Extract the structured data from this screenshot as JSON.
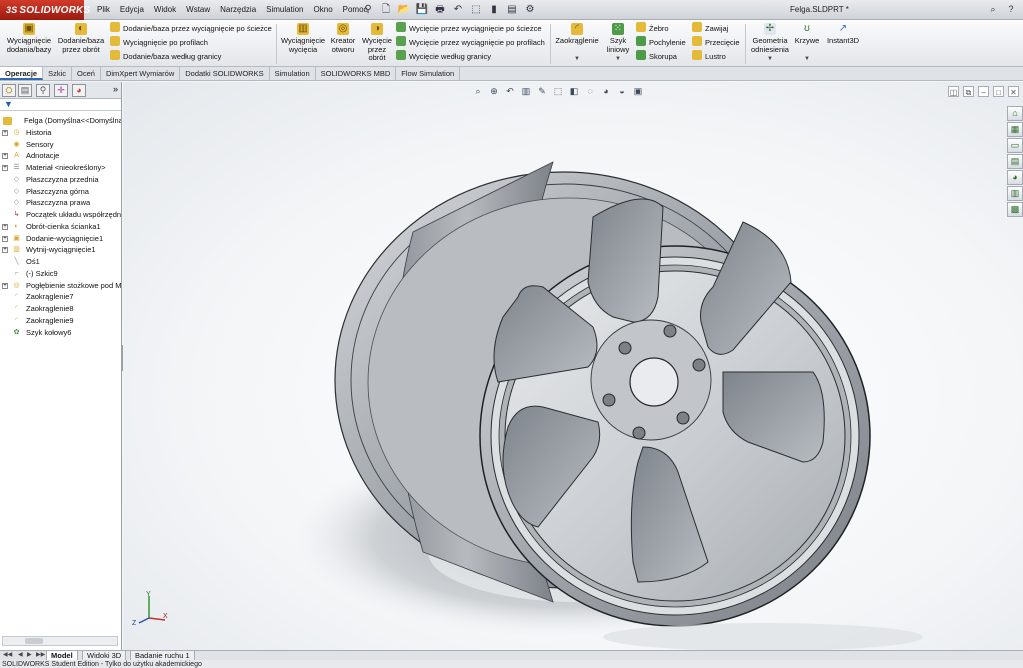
{
  "app": {
    "brand": "SOLIDWORKS",
    "brand_prefix": "3S",
    "document_title": "Felga.SLDPRT *"
  },
  "menu": [
    "Plik",
    "Edycja",
    "Widok",
    "Wstaw",
    "Narzędzia",
    "Simulation",
    "Okno",
    "Pomoc"
  ],
  "ribbon": {
    "extrude_boss": "Wyciągnięcie dodania/bazy",
    "revolve_boss": "Dodanie/baza przez obrót",
    "sweep_boss": "Dodanie/baza przez wyciągnięcie po ścieżce",
    "loft_boss": "Wyciągnięcie po profilach",
    "boundary_boss": "Dodanie/baza według granicy",
    "extrude_cut": "Wyciągnięcie wycięcia",
    "hole_wizard": "Kreator otworu",
    "revolve_cut": "Wycięcie przez obrót",
    "sweep_cut": "Wycięcie przez wyciągnięcie po ścieżce",
    "loft_cut": "Wycięcie przez wyciągnięcie po profilach",
    "boundary_cut": "Wycięcie według granicy",
    "fillet": "Zaokrąglenie",
    "linear_pattern": "Szyk liniowy",
    "rib": "Żebro",
    "draft": "Pochylenie",
    "shell": "Skorupa",
    "wrap": "Zawijaj",
    "intersect": "Przecięcie",
    "mirror": "Lustro",
    "ref_geometry": "Geometria odniesienia",
    "curves": "Krzywe",
    "instant3d": "Instant3D"
  },
  "tabs": [
    "Operacje",
    "Szkic",
    "Oceń",
    "DimXpert Wymiarów",
    "Dodatki SOLIDWORKS",
    "Simulation",
    "SOLIDWORKS MBD",
    "Flow Simulation"
  ],
  "active_tab": "Operacje",
  "feature_tree": {
    "root": "Felga  (Domyślna<<Domyślna>_Stan wyświetlania 1>)",
    "items": [
      {
        "label": "Historia",
        "expand": true,
        "icon": "history-icon",
        "color": "#d9a52b"
      },
      {
        "label": "Sensory",
        "expand": false,
        "icon": "sensor-icon",
        "color": "#d9a52b"
      },
      {
        "label": "Adnotacje",
        "expand": true,
        "icon": "annotation-icon",
        "color": "#d9a52b"
      },
      {
        "label": "Materiał <nieokreślony>",
        "expand": true,
        "icon": "material-icon",
        "color": "#6a7c8f"
      },
      {
        "label": "Płaszczyzna przednia",
        "expand": false,
        "icon": "plane-icon",
        "color": "#8a8f96"
      },
      {
        "label": "Płaszczyzna górna",
        "expand": false,
        "icon": "plane-icon",
        "color": "#8a8f96"
      },
      {
        "label": "Płaszczyzna prawa",
        "expand": false,
        "icon": "plane-icon",
        "color": "#8a8f96"
      },
      {
        "label": "Początek układu współrzędnych",
        "expand": false,
        "icon": "origin-icon",
        "color": "#b0332a"
      },
      {
        "label": "Obrót-cienka ścianka1",
        "expand": true,
        "icon": "revolve-icon",
        "color": "#d9a52b"
      },
      {
        "label": "Dodanie-wyciągnięcie1",
        "expand": true,
        "icon": "extrude-icon",
        "color": "#d9a52b"
      },
      {
        "label": "Wytnij-wyciągnięcie1",
        "expand": true,
        "icon": "cut-icon",
        "color": "#d9a52b"
      },
      {
        "label": "Oś1",
        "expand": false,
        "icon": "axis-icon",
        "color": "#8a8f96"
      },
      {
        "label": "(-) Szkic9",
        "expand": false,
        "icon": "sketch-icon",
        "color": "#8a8f96"
      },
      {
        "label": "Pogłębienie stożkowe pod M",
        "expand": true,
        "icon": "countersink-icon",
        "color": "#d9a52b"
      },
      {
        "label": "Zaokrąglenie7",
        "expand": false,
        "icon": "fillet-icon",
        "color": "#d9a52b"
      },
      {
        "label": "Zaokrąglenie8",
        "expand": false,
        "icon": "fillet-icon",
        "color": "#d9a52b"
      },
      {
        "label": "Zaokrąglenie9",
        "expand": false,
        "icon": "fillet-icon",
        "color": "#d9a52b"
      },
      {
        "label": "Szyk kołowy6",
        "expand": false,
        "icon": "circular-pattern-icon",
        "color": "#3f8f3f"
      }
    ]
  },
  "bottom_tabs": [
    "Model",
    "Widoki 3D",
    "Badanie ruchu 1"
  ],
  "active_bottom_tab": "Model",
  "status": "SOLIDWORKS Student Edition - Tylko do użytku akademickiego",
  "triad": {
    "x": "X",
    "y": "Y",
    "z": "Z"
  },
  "colors": {
    "accent": "#2f6ab3",
    "brand": "#c8331f",
    "part": "#9ea3a9"
  }
}
